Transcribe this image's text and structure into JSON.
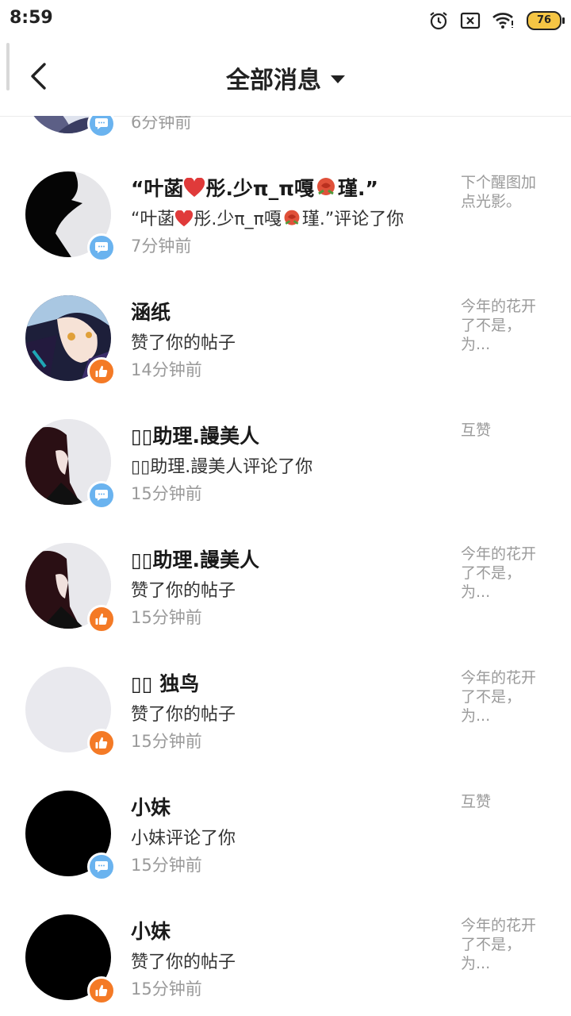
{
  "status_bar": {
    "time": "8:59",
    "battery": "76"
  },
  "header": {
    "title": "全部消息"
  },
  "messages": [
    {
      "name": "",
      "action": "",
      "time": "6分钟前",
      "preview": "",
      "type": "comment"
    },
    {
      "name_parts": [
        "“叶菡",
        "彤.少π_π嘎",
        "瑾.”"
      ],
      "action_parts": [
        "“叶菡",
        "彤.少π_π嘎",
        "瑾.”评论了你"
      ],
      "time": "7分钟前",
      "preview": "下个醒图加点光影。",
      "type": "comment"
    },
    {
      "name": "涵纸",
      "action": "赞了你的帖子",
      "time": "14分钟前",
      "preview": "今年的花开了不是，为...",
      "type": "like"
    },
    {
      "name": "▯▯助理.謾美人",
      "action": "▯▯助理.謾美人评论了你",
      "time": "15分钟前",
      "preview": "互赞",
      "type": "comment"
    },
    {
      "name": "▯▯助理.謾美人",
      "action": "赞了你的帖子",
      "time": "15分钟前",
      "preview": "今年的花开了不是，为...",
      "type": "like"
    },
    {
      "name": "▯▯ 独鸟",
      "action": "赞了你的帖子",
      "time": "15分钟前",
      "preview": "今年的花开了不是，为...",
      "type": "like"
    },
    {
      "name": "小妹",
      "action": "小妹评论了你",
      "time": "15分钟前",
      "preview": "互赞",
      "type": "comment"
    },
    {
      "name": "小妹",
      "action": "赞了你的帖子",
      "time": "15分钟前",
      "preview": "今年的花开了不是，为...",
      "type": "like"
    }
  ],
  "icons": {
    "back": "chevron-left-icon",
    "dropdown": "caret-down-icon",
    "comment_badge": "comment-bubble-icon",
    "like_badge": "thumbs-up-icon",
    "heart": "heart-emoji",
    "rose": "rose-emoji"
  },
  "colors": {
    "comment_badge": "#6ab3ef",
    "like_badge": "#f47a26",
    "battery": "#f5c544"
  }
}
